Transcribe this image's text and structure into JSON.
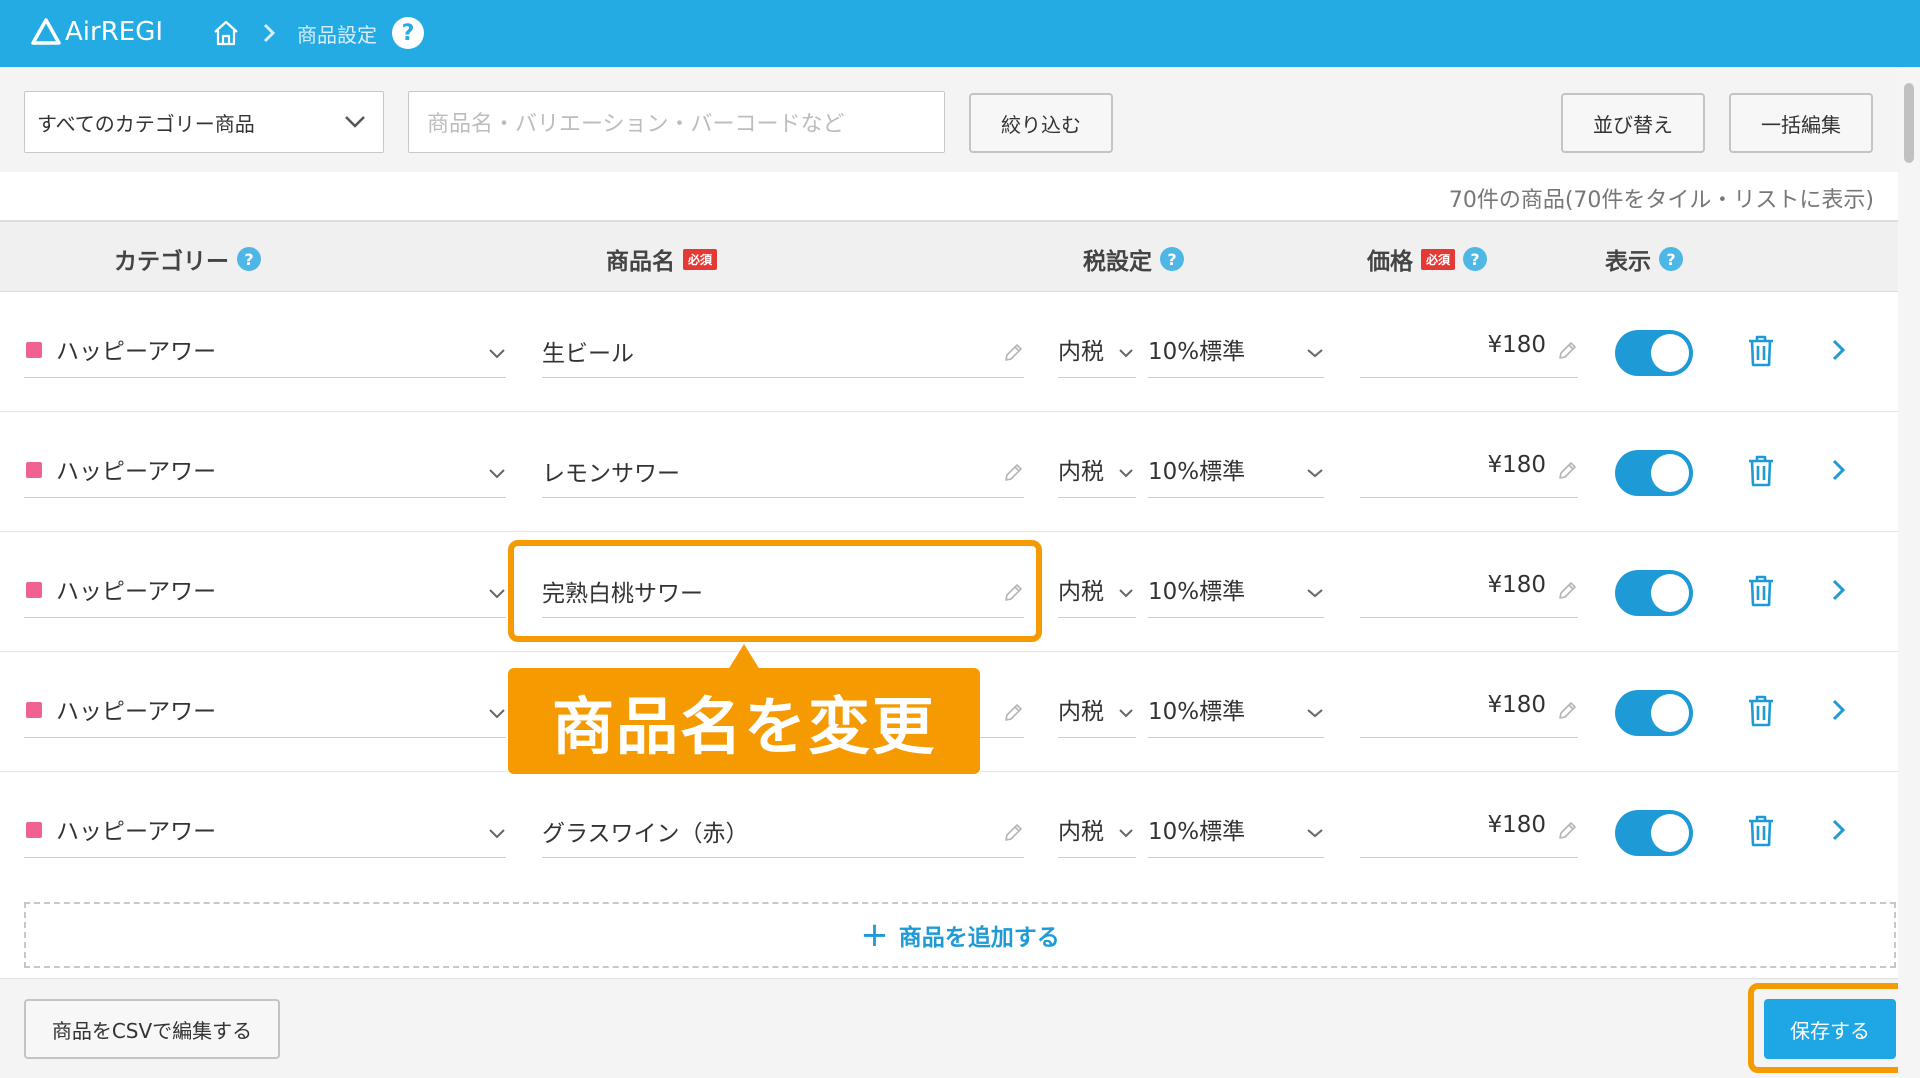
{
  "header": {
    "logo_text": "AirREGI",
    "breadcrumb": "商品設定",
    "help": "?"
  },
  "toolbar": {
    "category_select": "すべてのカテゴリー商品",
    "search_placeholder": "商品名・バリエーション・バーコードなど",
    "filter_label": "絞り込む",
    "sort_label": "並び替え",
    "bulk_edit_label": "一括編集"
  },
  "count_text": "70件の商品(70件をタイル・リストに表示)",
  "table": {
    "headers": {
      "category": "カテゴリー",
      "name": "商品名",
      "required": "必須",
      "tax": "税設定",
      "price": "価格",
      "show": "表示",
      "help": "?"
    },
    "rows": [
      {
        "category": "ハッピーアワー",
        "name": "生ビール",
        "tax_type": "内税",
        "tax_rate": "10%標準",
        "price": "¥180",
        "visible": true
      },
      {
        "category": "ハッピーアワー",
        "name": "レモンサワー",
        "tax_type": "内税",
        "tax_rate": "10%標準",
        "price": "¥180",
        "visible": true
      },
      {
        "category": "ハッピーアワー",
        "name": "完熟白桃サワー",
        "tax_type": "内税",
        "tax_rate": "10%標準",
        "price": "¥180",
        "visible": true
      },
      {
        "category": "ハッピーアワー",
        "name": "",
        "tax_type": "内税",
        "tax_rate": "10%標準",
        "price": "¥180",
        "visible": true
      },
      {
        "category": "ハッピーアワー",
        "name": "グラスワイン（赤）",
        "tax_type": "内税",
        "tax_rate": "10%標準",
        "price": "¥180",
        "visible": true
      }
    ]
  },
  "callout": "商品名を変更",
  "add_product_label": "商品を追加する",
  "footer": {
    "csv_label": "商品をCSVで編集する",
    "save_label": "保存する"
  },
  "colors": {
    "header_bg": "#25abe4",
    "accent": "#1e9bd7",
    "highlight": "#f59a00",
    "category_swatch": "#f06292",
    "required_badge": "#e53935"
  }
}
